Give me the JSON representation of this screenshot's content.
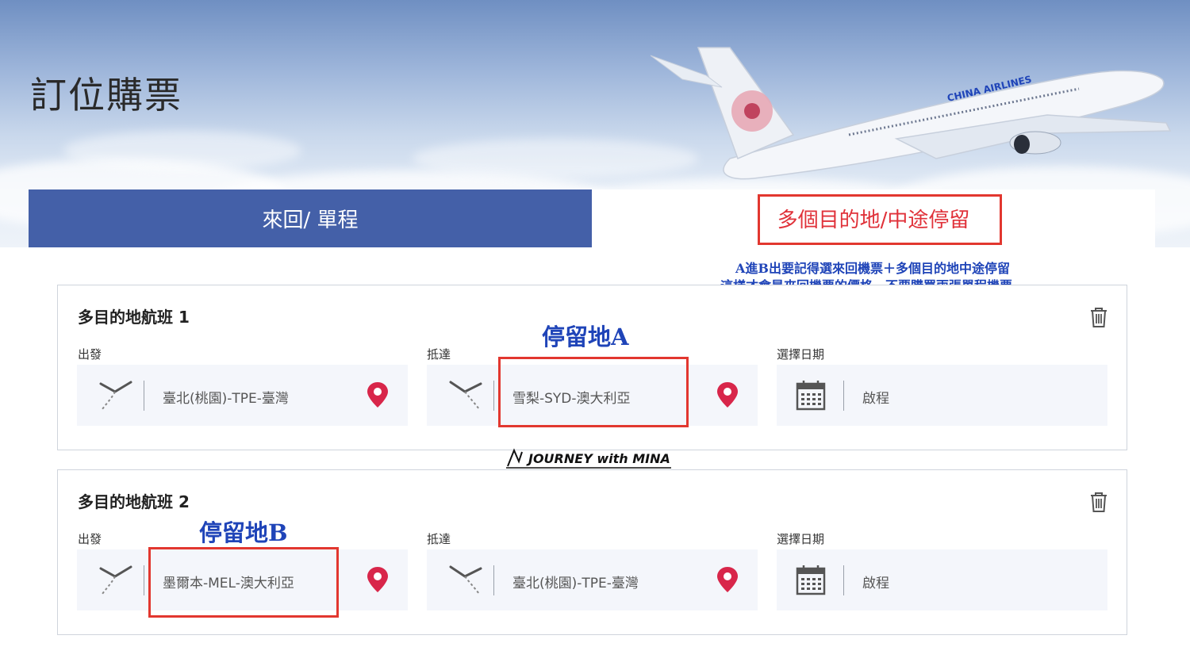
{
  "header": {
    "title": "訂位購票",
    "airline_name": "CHINA AIRLINES"
  },
  "tabs": [
    {
      "label": "來回/ 單程",
      "active": true
    },
    {
      "label": "多個目的地/中途停留",
      "active": false
    }
  ],
  "note": {
    "line1": "A進B出要記得選來回機票＋多個目的地中途停留",
    "line2": "這樣才會是來回機票的價格，不要購買兩張單程機票。"
  },
  "flights": [
    {
      "title": "多目的地航班 1",
      "depart_label": "出發",
      "depart_value": "臺北(桃園)-TPE-臺灣",
      "arrive_label": "抵達",
      "arrive_value": "雪梨-SYD-澳大利亞",
      "date_label": "選擇日期",
      "date_value": "啟程",
      "annotation": "停留地A"
    },
    {
      "title": "多目的地航班 2",
      "depart_label": "出發",
      "depart_value": "墨爾本-MEL-澳大利亞",
      "arrive_label": "抵達",
      "arrive_value": "臺北(桃園)-TPE-臺灣",
      "date_label": "選擇日期",
      "date_value": "啟程",
      "annotation": "停留地B"
    }
  ],
  "watermark": "JOURNEY with MINA",
  "colors": {
    "tab_active_bg": "#4460a8",
    "accent_red": "#e2372f",
    "pin_red": "#d8264a",
    "annotation_blue": "#1f44b8",
    "field_bg": "#f4f6fb"
  }
}
